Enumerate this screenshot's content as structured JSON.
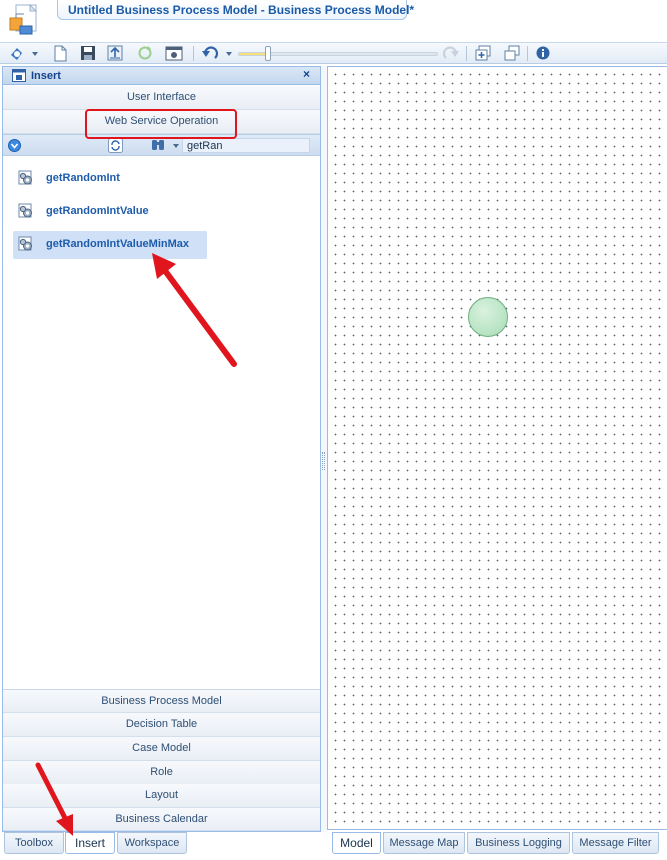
{
  "window": {
    "title": "Untitled Business Process Model - Business Process Model*"
  },
  "toolbar": {
    "zoom_fraction": 0.15,
    "icons": [
      "navigate-icon",
      "new-document-icon",
      "save-icon",
      "export-icon",
      "refresh-icon",
      "preview-icon",
      "undo-icon",
      "redo-icon",
      "add-window-icon",
      "cascade-window-icon",
      "info-icon"
    ]
  },
  "panel": {
    "title": "Insert",
    "close_label": "×",
    "top_sections": [
      {
        "label": "User Interface"
      },
      {
        "label": "Web Service Operation"
      }
    ],
    "filter": {
      "value": "getRan"
    },
    "items": [
      {
        "label": "getRandomInt"
      },
      {
        "label": "getRandomIntValue"
      },
      {
        "label": "getRandomIntValueMinMax",
        "selected": true
      }
    ],
    "bottom_sections": [
      {
        "label": "Business Process Model"
      },
      {
        "label": "Decision Table"
      },
      {
        "label": "Case Model"
      },
      {
        "label": "Role"
      },
      {
        "label": "Layout"
      },
      {
        "label": "Business Calendar"
      }
    ]
  },
  "left_tabs": [
    {
      "label": "Toolbox"
    },
    {
      "label": "Insert",
      "active": true
    },
    {
      "label": "Workspace"
    }
  ],
  "canvas_tabs": [
    {
      "label": "Model",
      "active": true
    },
    {
      "label": "Message Map"
    },
    {
      "label": "Business Logging"
    },
    {
      "label": "Message Filter"
    }
  ],
  "colors": {
    "accent": "#1a5aa6",
    "panel_border": "#99bbe8",
    "selection": "#cfe0f7",
    "start_event": "#a8dcb5",
    "annotation": "#e1151e"
  }
}
